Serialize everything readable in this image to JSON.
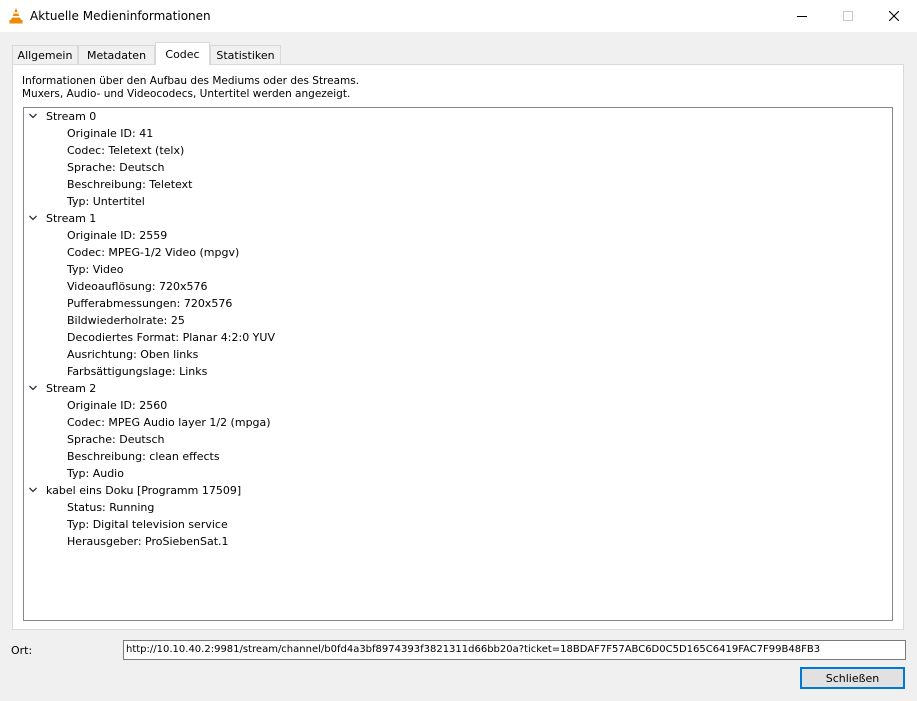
{
  "window": {
    "title": "Aktuelle Medieninformationen",
    "accent": "#0078d7",
    "icon": "vlc-cone-icon"
  },
  "tabs": [
    {
      "label": "Allgemein"
    },
    {
      "label": "Metadaten"
    },
    {
      "label": "Codec"
    },
    {
      "label": "Statistiken"
    }
  ],
  "active_tab": "Codec",
  "description": {
    "line1": "Informationen über den Aufbau des Mediums oder des Streams.",
    "line2": "Muxers, Audio- und Videocodecs, Untertitel werden angezeigt."
  },
  "tree": [
    {
      "label": "Stream 0",
      "children": [
        "Originale ID: 41",
        "Codec: Teletext (telx)",
        "Sprache: Deutsch",
        "Beschreibung: Teletext",
        "Typ: Untertitel"
      ]
    },
    {
      "label": "Stream 1",
      "children": [
        "Originale ID: 2559",
        "Codec: MPEG-1/2 Video (mpgv)",
        "Typ: Video",
        "Videoauflösung: 720x576",
        "Pufferabmessungen: 720x576",
        "Bildwiederholrate: 25",
        "Decodiertes Format: Planar 4:2:0 YUV",
        "Ausrichtung: Oben links",
        "Farbsättigungslage: Links"
      ]
    },
    {
      "label": "Stream 2",
      "children": [
        "Originale ID: 2560",
        "Codec: MPEG Audio layer 1/2 (mpga)",
        "Sprache: Deutsch",
        "Beschreibung: clean effects",
        "Typ: Audio"
      ]
    },
    {
      "label": "kabel eins Doku [Programm 17509]",
      "children": [
        "Status: Running",
        "Typ: Digital television service",
        "Herausgeber: ProSiebenSat.1"
      ]
    }
  ],
  "location": {
    "label": "Ort:",
    "value": "http://10.10.40.2:9981/stream/channel/b0fd4a3bf8974393f3821311d66bb20a?ticket=18BDAF7F57ABC6D0C5D165C6419FAC7F99B48FB3"
  },
  "close_button": {
    "label": "Schließen"
  }
}
